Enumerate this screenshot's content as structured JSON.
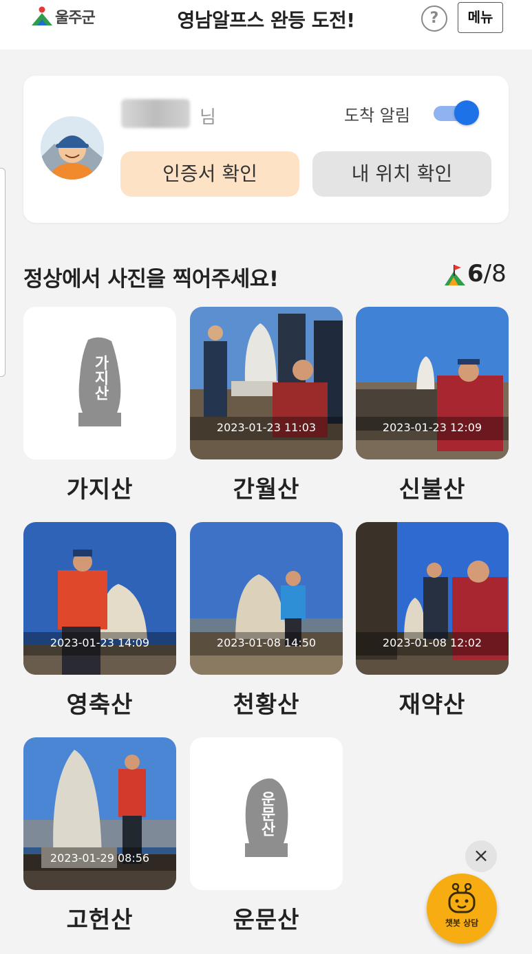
{
  "header": {
    "logo_text": "울주군",
    "title": "영남알프스 완등 도전!",
    "help_label": "?",
    "menu_label": "메뉴"
  },
  "profile": {
    "name_suffix": "님",
    "notify_label": "도착 알림",
    "notify_on": true,
    "cert_button": "인증서 확인",
    "location_button": "내 위치 확인"
  },
  "summit": {
    "title": "정상에서 사진을 찍어주세요!",
    "done": "6",
    "slash": "/",
    "total": "8"
  },
  "mountains": [
    {
      "name": "가지산",
      "timestamp": "",
      "stone_text": "가지산",
      "photo": false
    },
    {
      "name": "간월산",
      "timestamp": "2023-01-23 11:03",
      "photo": true
    },
    {
      "name": "신불산",
      "timestamp": "2023-01-23 12:09",
      "photo": true
    },
    {
      "name": "영축산",
      "timestamp": "2023-01-23 14:09",
      "photo": true
    },
    {
      "name": "천황산",
      "timestamp": "2023-01-08 14:50",
      "photo": true
    },
    {
      "name": "재약산",
      "timestamp": "2023-01-08 12:02",
      "photo": true
    },
    {
      "name": "고헌산",
      "timestamp": "2023-01-29 08:56",
      "photo": true
    },
    {
      "name": "운문산",
      "timestamp": "",
      "stone_text": "운문산",
      "photo": false
    }
  ],
  "chatbot": {
    "close_label": "×",
    "label": "챗봇 상담"
  },
  "colors": {
    "accent_blue": "#1e72e8",
    "cert_bg": "#fde2c5",
    "chatbot_bg": "#f7ad12"
  }
}
